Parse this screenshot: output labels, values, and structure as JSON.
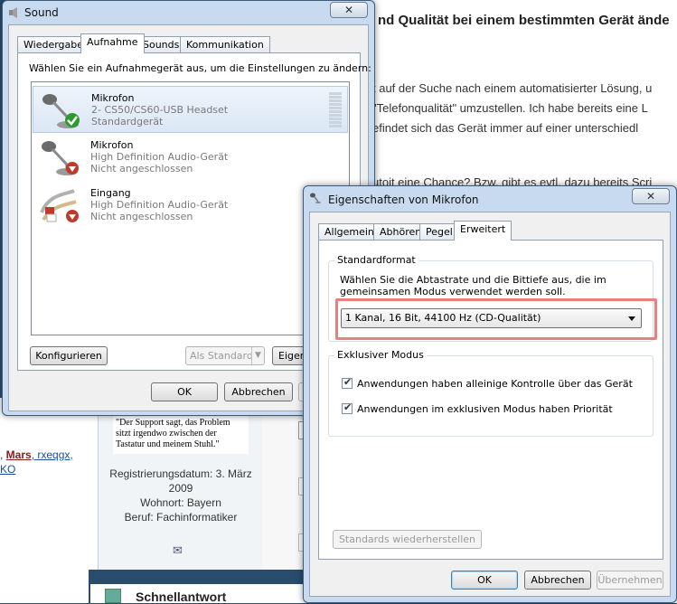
{
  "background_page": {
    "heading": "nd Qualität bei einem bestimmten Gerät ände",
    "lines": [
      "t auf der Suche nach einem automatisierter Lösung, u",
      "\"Telefonqualität\" umzustellen. Ich habe bereits eine L",
      "efindet sich das Gerät immer auf einer unterschiedl",
      "utoit eine Chance? Bzw. gibt es evtl. dazu bereits Scri"
    ],
    "left_names_line1_prefix": ", ",
    "left_names_mars": "Mars",
    "left_names_line1_suffix": ", rxeqgx,",
    "left_names_line2": "KO",
    "quote": "\"Der Support sagt, das Problem sitzt irgendwo zwischen der Tastatur und meinem Stuhl.\"",
    "registration": "Registrierungsdatum: 3. März 2009",
    "residence": "Wohnort: Bayern",
    "job": "Beruf: Fachinformatiker",
    "quick_reply": "Schnellantwort"
  },
  "sound_window": {
    "title": "Sound",
    "close_label": "✕",
    "tabs": [
      "Wiedergabe",
      "Aufnahme",
      "Sounds",
      "Kommunikation"
    ],
    "active_tab": "Aufnahme",
    "instruction": "Wählen Sie ein Aufnahmegerät aus, um die Einstellungen zu ändern:",
    "devices": [
      {
        "name": "Mikrofon",
        "line1": "2- CS50/CS60-USB Headset",
        "line2": "Standardgerät",
        "icon": "microphone-icon",
        "status": "default-check"
      },
      {
        "name": "Mikrofon",
        "line1": "High Definition Audio-Gerät",
        "line2": "Nicht angeschlossen",
        "icon": "microphone-icon",
        "status": "unplugged"
      },
      {
        "name": "Eingang",
        "line1": "High Definition Audio-Gerät",
        "line2": "Nicht angeschlossen",
        "icon": "rca-cable-icon",
        "status": "unplugged"
      }
    ],
    "configure_label": "Konfigurieren",
    "set_default_label": "Als Standard",
    "properties_label": "Eigen",
    "ok_label": "OK",
    "cancel_label": "Abbrechen"
  },
  "mic_window": {
    "title": "Eigenschaften von Mikrofon",
    "close_label": "✕",
    "tabs": [
      "Allgemein",
      "Abhören",
      "Pegel",
      "Erweitert"
    ],
    "active_tab": "Erweitert",
    "default_format_title": "Standardformat",
    "default_format_desc_line1": "Wählen Sie die Abtastrate und die Bittiefe aus, die im",
    "default_format_desc_line2": "gemeinsamen Modus verwendet werden soll.",
    "format_value": "1 Kanal, 16 Bit, 44100 Hz (CD-Qualität)",
    "exclusive_title": "Exklusiver Modus",
    "exclusive_options": [
      {
        "label": "Anwendungen haben alleinige Kontrolle über das Gerät",
        "checked": true
      },
      {
        "label": "Anwendungen im exklusiven Modus haben Priorität",
        "checked": true
      }
    ],
    "restore_defaults_label": "Standards wiederherstellen",
    "ok_label": "OK",
    "cancel_label": "Abbrechen",
    "apply_label": "Übernehmen",
    "highlight_color": "#e88080"
  }
}
